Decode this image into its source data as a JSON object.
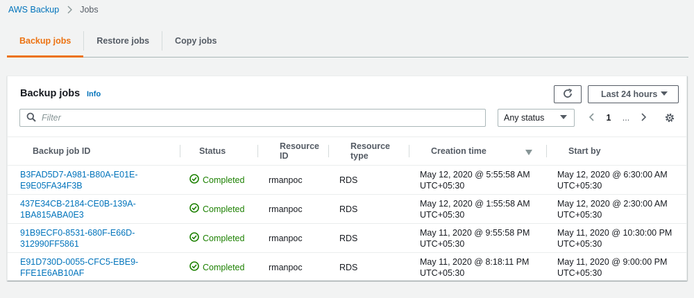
{
  "breadcrumb": {
    "root": "AWS Backup",
    "current": "Jobs"
  },
  "tabs": [
    {
      "label": "Backup jobs",
      "active": true
    },
    {
      "label": "Restore jobs",
      "active": false
    },
    {
      "label": "Copy jobs",
      "active": false
    }
  ],
  "panel": {
    "title": "Backup jobs",
    "info_label": "Info",
    "time_range": "Last 24 hours",
    "filter_placeholder": "Filter",
    "status_filter": "Any status",
    "current_page": "1",
    "ellipsis": "..."
  },
  "table": {
    "columns": [
      "Backup job ID",
      "Status",
      "Resource ID",
      "Resource type",
      "Creation time",
      "Start by"
    ],
    "rows": [
      {
        "id_line1": "B3FAD5D7-A981-B80A-E01E-",
        "id_line2": "E9E05FA34F3B",
        "status": "Completed",
        "resource_id": "rmanpoc",
        "resource_type": "RDS",
        "creation_line1": "May 12, 2020 @ 5:55:58 AM",
        "creation_line2": "UTC+05:30",
        "startby_line1": "May 12, 2020 @ 6:30:00 AM",
        "startby_line2": "UTC+05:30"
      },
      {
        "id_line1": "437E34CB-2184-CE0B-139A-",
        "id_line2": "1BA815ABA0E3",
        "status": "Completed",
        "resource_id": "rmanpoc",
        "resource_type": "RDS",
        "creation_line1": "May 12, 2020 @ 1:55:58 AM",
        "creation_line2": "UTC+05:30",
        "startby_line1": "May 12, 2020 @ 2:30:00 AM",
        "startby_line2": "UTC+05:30"
      },
      {
        "id_line1": "91B9ECF0-8531-680F-E66D-",
        "id_line2": "312990FF5861",
        "status": "Completed",
        "resource_id": "rmanpoc",
        "resource_type": "RDS",
        "creation_line1": "May 11, 2020 @ 9:55:58 PM",
        "creation_line2": "UTC+05:30",
        "startby_line1": "May 11, 2020 @ 10:30:00 PM",
        "startby_line2": "UTC+05:30"
      },
      {
        "id_line1": "E91D730D-0055-CFC5-EBE9-",
        "id_line2": "FFE1E6AB10AF",
        "status": "Completed",
        "resource_id": "rmanpoc",
        "resource_type": "RDS",
        "creation_line1": "May 11, 2020 @ 8:18:11 PM",
        "creation_line2": "UTC+05:30",
        "startby_line1": "May 11, 2020 @ 9:00:00 PM",
        "startby_line2": "UTC+05:30"
      }
    ]
  },
  "icons": {
    "breadcrumb_separator": "chevron-right-icon",
    "refresh": "refresh-icon",
    "dropdown": "caret-down-icon",
    "search": "search-icon",
    "pager_prev": "chevron-left-icon",
    "pager_next": "chevron-right-icon",
    "settings": "gear-icon",
    "sort": "sort-down-icon",
    "status_ok": "check-circle-icon"
  },
  "colors": {
    "link": "#0073bb",
    "active_tab": "#ec7211",
    "success": "#1d8102",
    "background": "#f2f3f3"
  }
}
